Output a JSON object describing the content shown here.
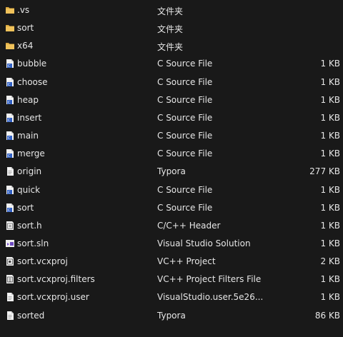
{
  "files": [
    {
      "name": ".vs",
      "type": "文件夹",
      "size": "",
      "icon": "folder-icon"
    },
    {
      "name": "sort",
      "type": "文件夹",
      "size": "",
      "icon": "folder-icon"
    },
    {
      "name": "x64",
      "type": "文件夹",
      "size": "",
      "icon": "folder-icon"
    },
    {
      "name": "bubble",
      "type": "C Source File",
      "size": "1 KB",
      "icon": "c-source-file-icon"
    },
    {
      "name": "choose",
      "type": "C Source File",
      "size": "1 KB",
      "icon": "c-source-file-icon"
    },
    {
      "name": "heap",
      "type": "C Source File",
      "size": "1 KB",
      "icon": "c-source-file-icon"
    },
    {
      "name": "insert",
      "type": "C Source File",
      "size": "1 KB",
      "icon": "c-source-file-icon"
    },
    {
      "name": "main",
      "type": "C Source File",
      "size": "1 KB",
      "icon": "c-source-file-icon"
    },
    {
      "name": "merge",
      "type": "C Source File",
      "size": "1 KB",
      "icon": "c-source-file-icon"
    },
    {
      "name": "origin",
      "type": "Typora",
      "size": "277 KB",
      "icon": "text-document-icon"
    },
    {
      "name": "quick",
      "type": "C Source File",
      "size": "1 KB",
      "icon": "c-source-file-icon"
    },
    {
      "name": "sort",
      "type": "C Source File",
      "size": "1 KB",
      "icon": "c-source-file-icon"
    },
    {
      "name": "sort.h",
      "type": "C/C++ Header",
      "size": "1 KB",
      "icon": "header-file-icon"
    },
    {
      "name": "sort.sln",
      "type": "Visual Studio Solution",
      "size": "1 KB",
      "icon": "visual-studio-solution-icon"
    },
    {
      "name": "sort.vcxproj",
      "type": "VC++ Project",
      "size": "2 KB",
      "icon": "vc-project-icon"
    },
    {
      "name": "sort.vcxproj.filters",
      "type": "VC++ Project Filters File",
      "size": "1 KB",
      "icon": "vc-project-filters-icon"
    },
    {
      "name": "sort.vcxproj.user",
      "type": "VisualStudio.user.5e26...",
      "size": "1 KB",
      "icon": "text-document-icon"
    },
    {
      "name": "sorted",
      "type": "Typora",
      "size": "86 KB",
      "icon": "text-document-icon"
    }
  ],
  "colors": {
    "background": "#191919",
    "text": "#e6e6e6",
    "folder": "#e8b64a",
    "c_source_accent": "#3a66c8"
  }
}
